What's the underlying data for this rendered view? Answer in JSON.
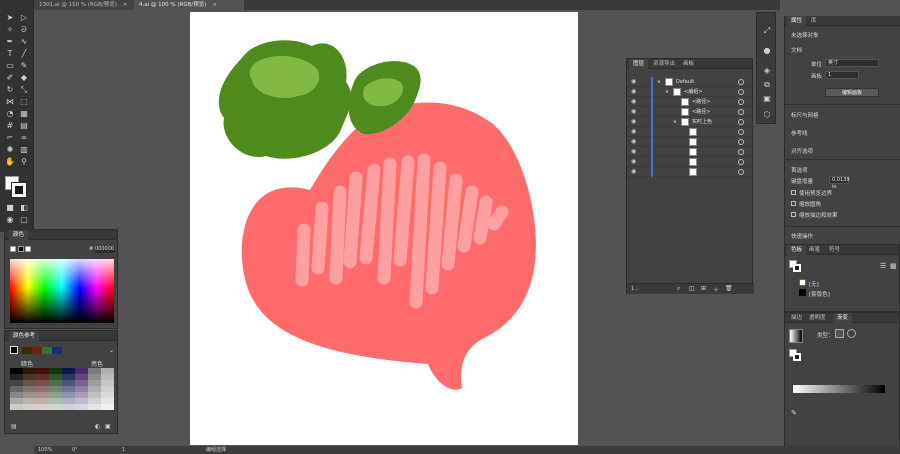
{
  "tabs": [
    {
      "label": "1301.ai @ 150 % (RGB/预览)",
      "close": "×"
    },
    {
      "label": "4.ai @ 100 % (RGB/预览)",
      "close": "×"
    }
  ],
  "color_panel": {
    "title": "颜色",
    "hex_label": "#",
    "hex_value": "000000"
  },
  "guide_panel": {
    "title": "颜色参考",
    "col_left": "暗色",
    "col_right": "亮色"
  },
  "layers_panel": {
    "tabs": [
      "图层",
      "资源导出",
      "画板"
    ],
    "rows": [
      {
        "label": "Default",
        "indent": 0,
        "arrow": "∨"
      },
      {
        "label": "<编组>",
        "indent": 1,
        "arrow": "∨"
      },
      {
        "label": "<路径>",
        "indent": 2,
        "arrow": ""
      },
      {
        "label": "<路径>",
        "indent": 2,
        "arrow": ""
      },
      {
        "label": "实时上色",
        "indent": 2,
        "arrow": "∨"
      },
      {
        "label": "",
        "indent": 3,
        "arrow": ""
      },
      {
        "label": "",
        "indent": 3,
        "arrow": ""
      },
      {
        "label": "",
        "indent": 3,
        "arrow": ""
      },
      {
        "label": "",
        "indent": 3,
        "arrow": ""
      },
      {
        "label": "",
        "indent": 3,
        "arrow": ""
      }
    ],
    "footer_count": "1..."
  },
  "properties_panel": {
    "tabs": [
      "属性",
      "库"
    ],
    "no_selection": "未选择对象",
    "document_label": "文档",
    "unit_label": "单位",
    "unit_value": "英寸",
    "artboard_label": "画板",
    "artboard_value": "1",
    "edit_artboards_button": "编辑画板",
    "rulers_label": "标尺与网格",
    "guides_label": "参考线",
    "snap_label": "对齐选项",
    "prefs_label": "首选项",
    "keyboard_inc_label": "键盘增量",
    "keyboard_inc_value": "0.0139 in",
    "opt_preview_bounds": "使用预览边界",
    "opt_scale_corners": "缩放圆角",
    "opt_scale_strokes": "缩放描边和效果",
    "quick_actions_label": "快速操作"
  },
  "swatch_panel": {
    "tabs": [
      "色板",
      "画笔",
      "符号"
    ],
    "row1": "[无]",
    "row2": "[套版色]"
  },
  "gradient_panel": {
    "tabs": [
      "描边",
      "透明度",
      "渐变"
    ],
    "type_label": "类型："
  },
  "status_bar": {
    "zoom": "100%",
    "angle": "0°",
    "artboard": "1",
    "tool_label": "编组选择"
  },
  "colors": {
    "leaf_dark": "#4e8a1c",
    "leaf_light": "#82b944",
    "body": "#ff6b6b",
    "highlight": "#ffa0a0"
  }
}
